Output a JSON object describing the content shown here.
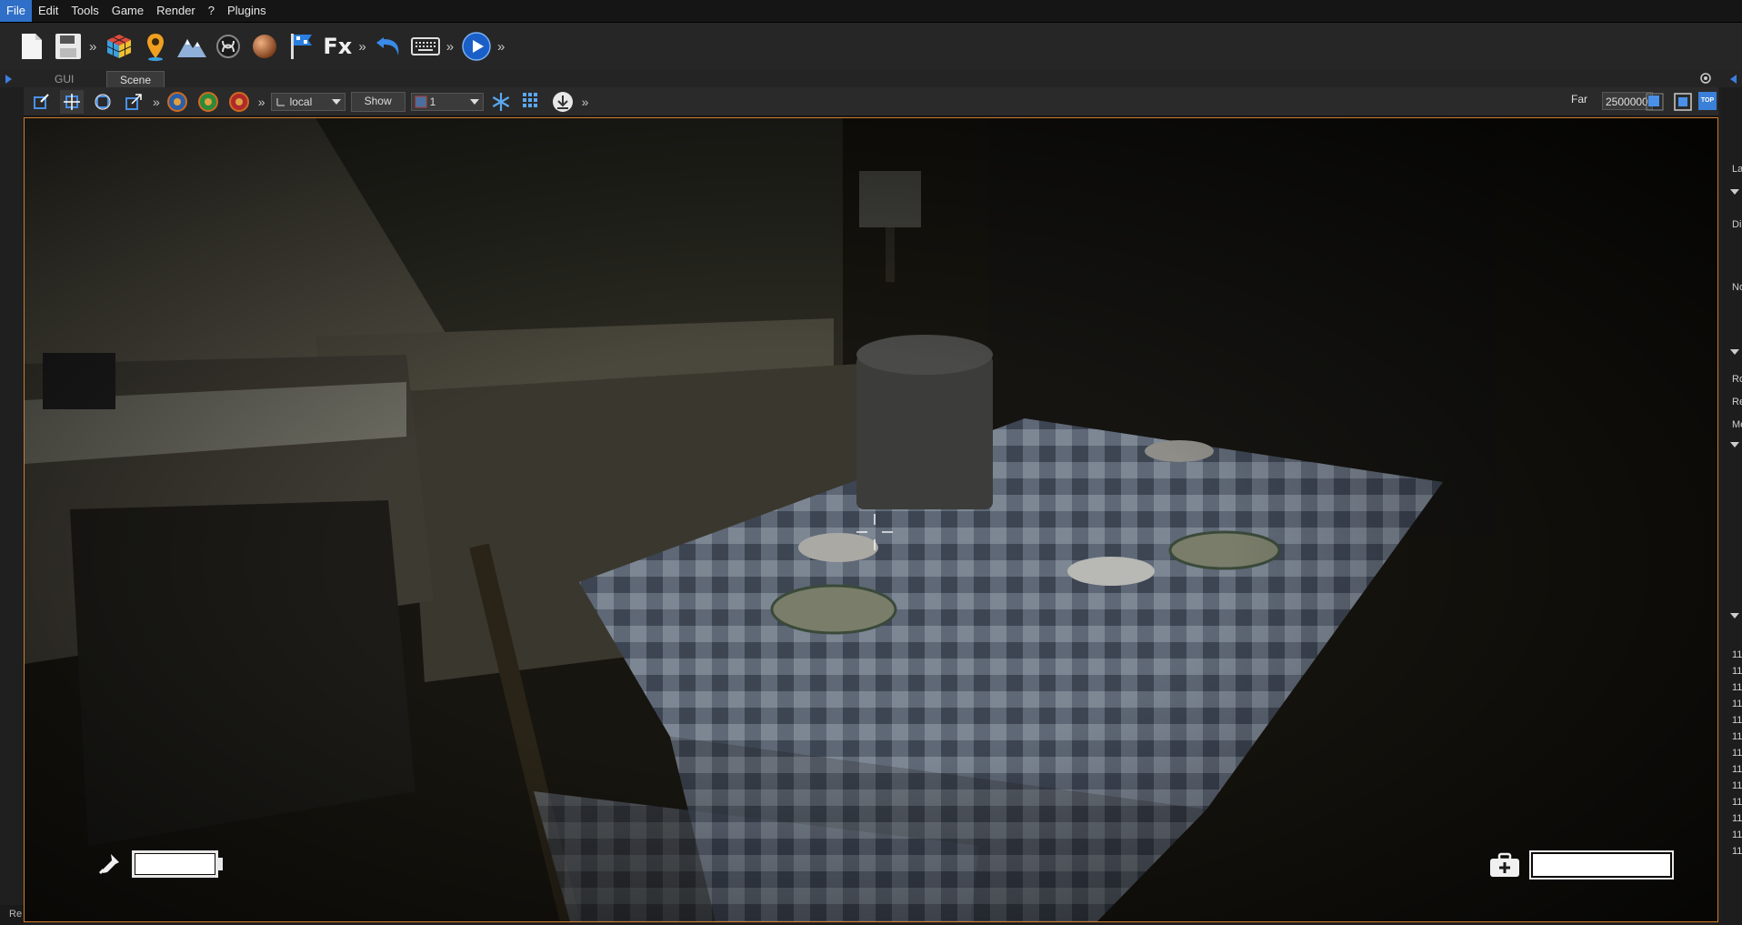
{
  "menu": {
    "items": [
      "File",
      "Edit",
      "Tools",
      "Game",
      "Render",
      "?",
      "Plugins"
    ],
    "active": "File"
  },
  "toolbar": {
    "icons": [
      "new-file-icon",
      "save-icon",
      "rubiks-cube-icon",
      "map-pin-icon",
      "mountain-terrain-icon",
      "knot-icon",
      "sphere-material-icon",
      "flag-icon",
      "fx-icon",
      "undo-icon",
      "keyboard-icon",
      "play-icon"
    ],
    "fx_label": "Fx",
    "more": "»"
  },
  "tabs": [
    "GUI",
    "Scene"
  ],
  "active_tab": "Scene",
  "scene_toolbar": {
    "space_value": "local",
    "show_label": "Show",
    "layer_value": "1",
    "far_label": "Far",
    "far_value": "2500000",
    "top_label": "TOP",
    "more": "»"
  },
  "right_panel": {
    "texts": [
      "La",
      "Di",
      "No",
      "Ro",
      "Re",
      "Me",
      "11",
      "11",
      "11",
      "11",
      "11",
      "11",
      "11",
      "11",
      "11",
      "11",
      "11",
      "11",
      "11"
    ]
  },
  "status": {
    "text": "Re"
  },
  "hud": {
    "flashlight_battery_level": 1.0,
    "health_level": 1.0
  },
  "colors": {
    "accent": "#2f6fc8",
    "viewport_border": "#d07a2a",
    "hud_white": "#ffffff"
  }
}
